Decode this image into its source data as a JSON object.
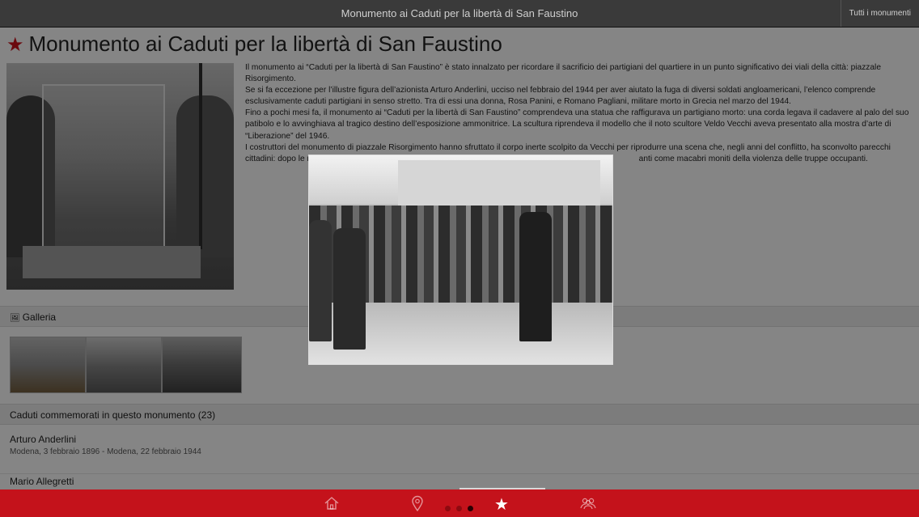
{
  "window": {
    "title": "Monumento ai Caduti per la libertà di San Faustino",
    "right_button": "Tutti i monumenti"
  },
  "page": {
    "title": "Monumento ai Caduti per la libertà di San Faustino",
    "description": [
      "Il monumento ai “Caduti per la libertà di San Faustino” è stato innalzato per ricordare il sacrificio dei partigiani del quartiere in un punto significativo dei viali della città: piazzale Risorgimento.",
      "Se si fa eccezione per l’illustre figura dell’azionista Arturo Anderlini, ucciso nel febbraio del 1944 per aver aiutato la fuga di diversi soldati angloamericani, l’elenco comprende esclusivamente caduti partigiani in senso stretto. Tra di essi una donna, Rosa Panini, e Romano Pagliani, militare morto in Grecia nel marzo del 1944.",
      "Fino a pochi mesi fa, il monumento ai “Caduti per la libertà di San Faustino” comprendeva una statua che raffigurava un partigiano morto: una corda legava il cadavere al palo del suo patibolo e lo avvinghiava al tragico destino dell’esposizione ammonitrice. La scultura riprendeva il modello che il noto scultore Veldo Vecchi aveva presentato alla mostra d’arte di “Liberazione” del 1946.",
      "I costruttori del monumento di piazzale Risorgimento hanno sfruttato il corpo inerte scolpito da Vecchi per riprodurre una scena che, negli anni del conflitto, ha sconvolto parecchi cittadini: dopo le rappresa",
      "anti come macabri moniti della violenza delle truppe occupanti."
    ]
  },
  "gallery": {
    "label": "Galleria"
  },
  "fallen": {
    "header": "Caduti commemorati in questo monumento (23)",
    "people": [
      {
        "name": "Arturo Anderlini",
        "dates": "Modena, 3 febbraio 1896 - Modena, 22 febbraio 1944"
      },
      {
        "name": "Mario Allegretti",
        "dates": ""
      }
    ]
  },
  "tabbar": {
    "icons": [
      "home-icon",
      "map-pin-icon",
      "star-icon",
      "people-icon"
    ],
    "page_dots": 3,
    "active_dot": 2
  },
  "colors": {
    "accent": "#c4121b",
    "topbar": "#3a3a3a"
  }
}
